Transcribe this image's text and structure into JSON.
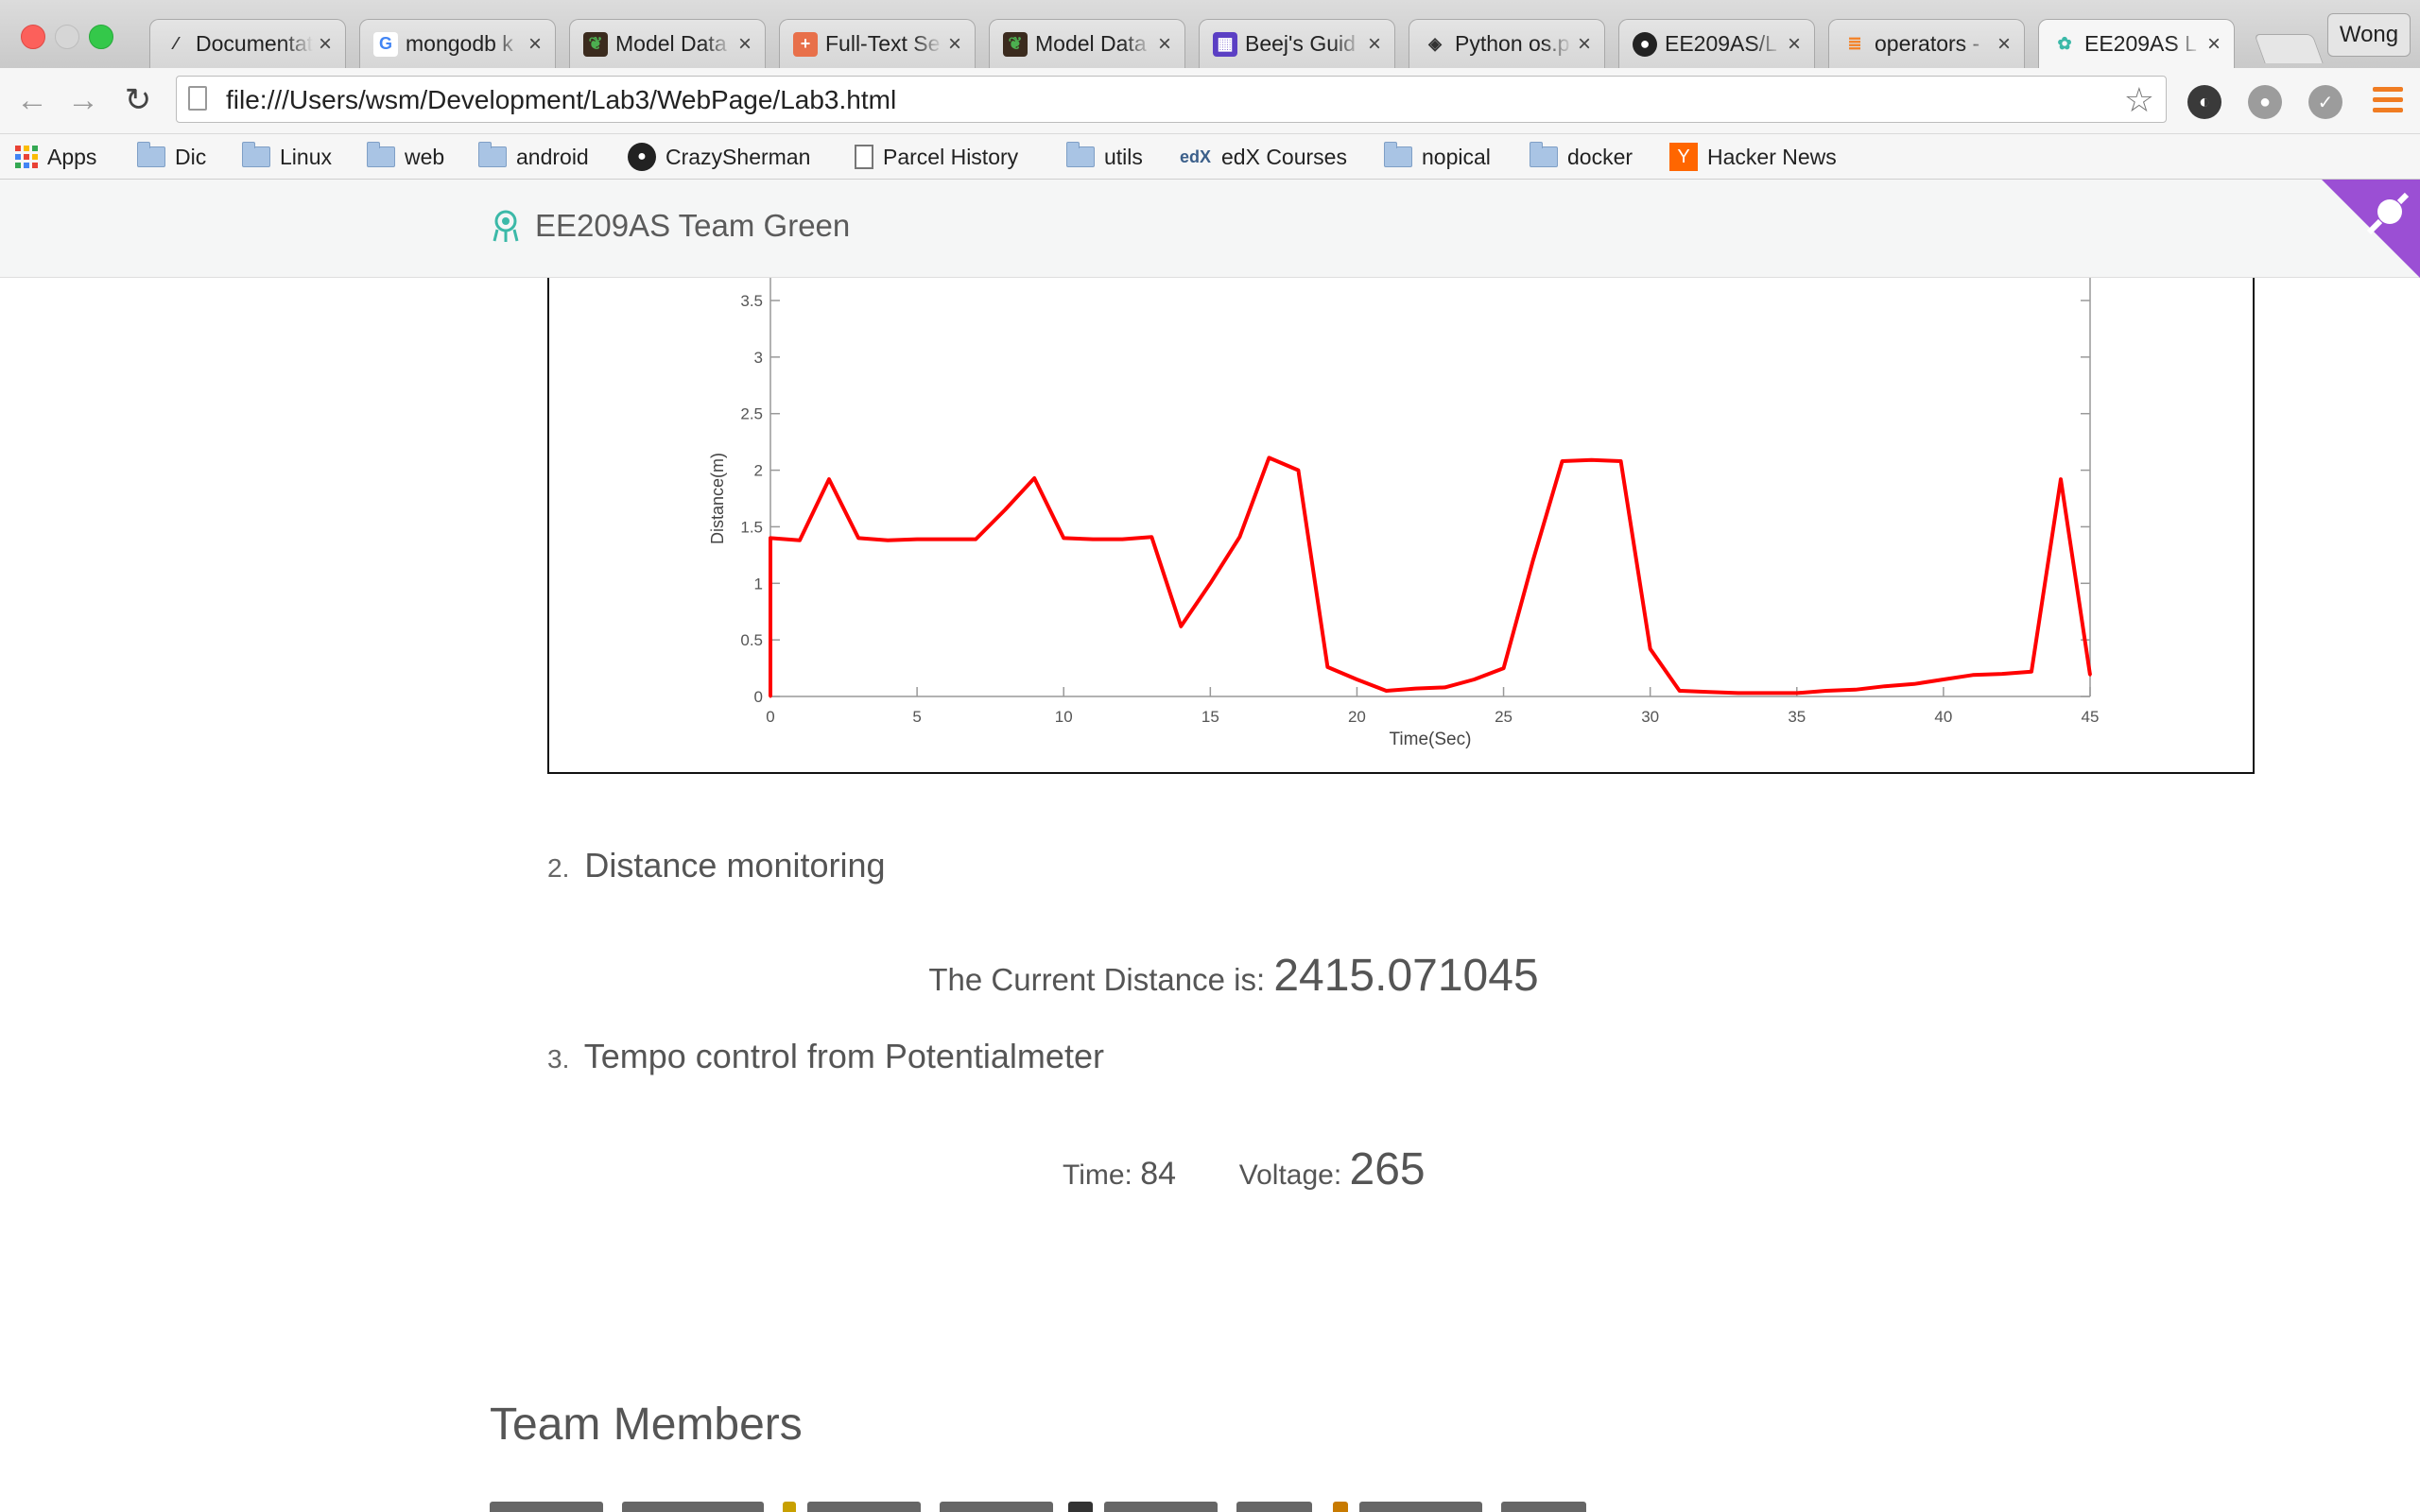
{
  "browser": {
    "tabs": [
      {
        "title": "Documentation",
        "favicon": "feather-icon"
      },
      {
        "title": "mongodb k",
        "favicon": "google-icon"
      },
      {
        "title": "Model Data",
        "favicon": "mongodb-leaf-icon"
      },
      {
        "title": "Full-Text Se",
        "favicon": "plus-icon"
      },
      {
        "title": "Model Data",
        "favicon": "mongodb-leaf-icon"
      },
      {
        "title": "Beej's Guid",
        "favicon": "beej-icon"
      },
      {
        "title": "Python os.p",
        "favicon": "python-icon"
      },
      {
        "title": "EE209AS/L",
        "favicon": "github-icon"
      },
      {
        "title": "operators -",
        "favicon": "stackoverflow-icon"
      },
      {
        "title": "EE209AS L",
        "favicon": "team-logo-icon",
        "active": true
      }
    ],
    "profile_name": "Wong",
    "url": "file:///Users/wsm/Development/Lab3/WebPage/Lab3.html",
    "bookmarks": [
      {
        "label": "Apps",
        "icon": "apps-grid-icon"
      },
      {
        "label": "Dic",
        "icon": "folder-icon"
      },
      {
        "label": "Linux",
        "icon": "folder-icon"
      },
      {
        "label": "web",
        "icon": "folder-icon"
      },
      {
        "label": "android",
        "icon": "folder-icon"
      },
      {
        "label": "CrazySherman",
        "icon": "github-icon"
      },
      {
        "label": "Parcel History",
        "icon": "document-icon"
      },
      {
        "label": "utils",
        "icon": "folder-icon"
      },
      {
        "label": "edX Courses",
        "icon": "edx-icon"
      },
      {
        "label": "nopical",
        "icon": "folder-icon"
      },
      {
        "label": "docker",
        "icon": "folder-icon"
      },
      {
        "label": "Hacker News",
        "icon": "y-combinator-icon"
      }
    ]
  },
  "site": {
    "brand": "EE209AS Team Green",
    "accent_color": "#3bb9a8",
    "corner_color": "#9b4fd4"
  },
  "sections": {
    "distance": {
      "number": "2.",
      "title": "Distance monitoring"
    },
    "current_distance": {
      "label": "The Current Distance is:",
      "value": "2415.071045"
    },
    "tempo": {
      "number": "3.",
      "title": "Tempo control from Potentialmeter"
    },
    "time": {
      "label": "Time:",
      "value": "84"
    },
    "voltage": {
      "label": "Voltage:",
      "value": "265"
    }
  },
  "team": {
    "title": "Team Members"
  },
  "chart_data": {
    "type": "line",
    "xlabel": "Time(Sec)",
    "ylabel": "Distance(m)",
    "xlim": [
      0,
      45
    ],
    "ylim": [
      0,
      3.5
    ],
    "xticks": [
      0,
      5,
      10,
      15,
      20,
      25,
      30,
      35,
      40,
      45
    ],
    "yticks": [
      0,
      0.5,
      1,
      1.5,
      2,
      2.5,
      3,
      3.5
    ],
    "line_color": "#ff0000",
    "series": [
      {
        "x": [
          0,
          0,
          1,
          2,
          3,
          4,
          5,
          6,
          7,
          8,
          9,
          10,
          11,
          12,
          13,
          14,
          15,
          16,
          17,
          18,
          19,
          20,
          21,
          22,
          23,
          24,
          25,
          26,
          27,
          28,
          29,
          30,
          31,
          32,
          33,
          34,
          35,
          36,
          37,
          38,
          39,
          40,
          41,
          42,
          43,
          44,
          45
        ],
        "y": [
          0,
          1.4,
          1.38,
          1.92,
          1.4,
          1.38,
          1.39,
          1.39,
          1.39,
          1.65,
          1.93,
          1.4,
          1.39,
          1.39,
          1.41,
          0.62,
          1.0,
          1.41,
          2.11,
          2.0,
          0.26,
          0.15,
          0.05,
          0.07,
          0.08,
          0.15,
          0.25,
          1.2,
          2.08,
          2.09,
          2.08,
          0.42,
          0.05,
          0.04,
          0.03,
          0.03,
          0.03,
          0.05,
          0.06,
          0.09,
          0.11,
          0.15,
          0.19,
          0.2,
          0.22,
          1.92,
          0.19
        ]
      }
    ]
  }
}
